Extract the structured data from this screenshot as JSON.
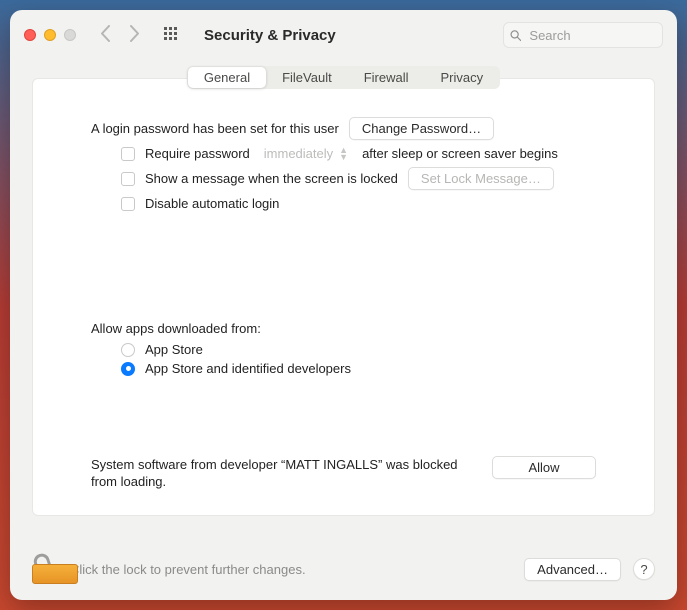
{
  "window": {
    "title": "Security & Privacy",
    "search_placeholder": "Search"
  },
  "tabs": {
    "general": "General",
    "filevault": "FileVault",
    "firewall": "Firewall",
    "privacy": "Privacy"
  },
  "general": {
    "login_password_set": "A login password has been set for this user",
    "change_password": "Change Password…",
    "require_password_label": "Require password",
    "require_password_delay": "immediately",
    "require_password_after": "after sleep or screen saver begins",
    "show_message_label": "Show a message when the screen is locked",
    "set_lock_message": "Set Lock Message…",
    "disable_auto_login": "Disable automatic login",
    "allow_apps_heading": "Allow apps downloaded from:",
    "allow_option_appstore": "App Store",
    "allow_option_identified": "App Store and identified developers",
    "blocked_msg": "System software from developer “MATT INGALLS” was blocked from loading.",
    "allow_button": "Allow"
  },
  "footer": {
    "lock_hint": "Click the lock to prevent further changes.",
    "advanced": "Advanced…",
    "help": "?"
  }
}
